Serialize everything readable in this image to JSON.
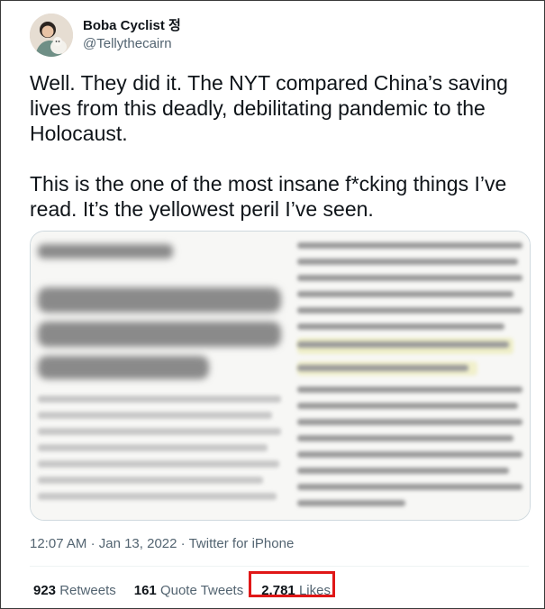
{
  "user": {
    "display_name": "Boba Cyclist 정",
    "handle": "@Tellythecairn"
  },
  "tweet": {
    "paragraph_1": "Well. They did it. The NYT compared China’s saving lives from this deadly, debilitating pandemic to the Holocaust.",
    "paragraph_2": "This is the one of the most insane f*cking things I’ve read. It’s the yellowest peril I’ve seen."
  },
  "meta": {
    "time": "12:07 AM",
    "date": "Jan 13, 2022",
    "source": "Twitter for iPhone",
    "separator": "·"
  },
  "stats": {
    "retweets_count": "923",
    "retweets_label": "Retweets",
    "quotes_count": "161",
    "quotes_label": "Quote Tweets",
    "likes_count": "2,781",
    "likes_label": "Likes"
  },
  "colors": {
    "highlight": "#e01717",
    "muted": "#536471",
    "text": "#0f1419"
  }
}
